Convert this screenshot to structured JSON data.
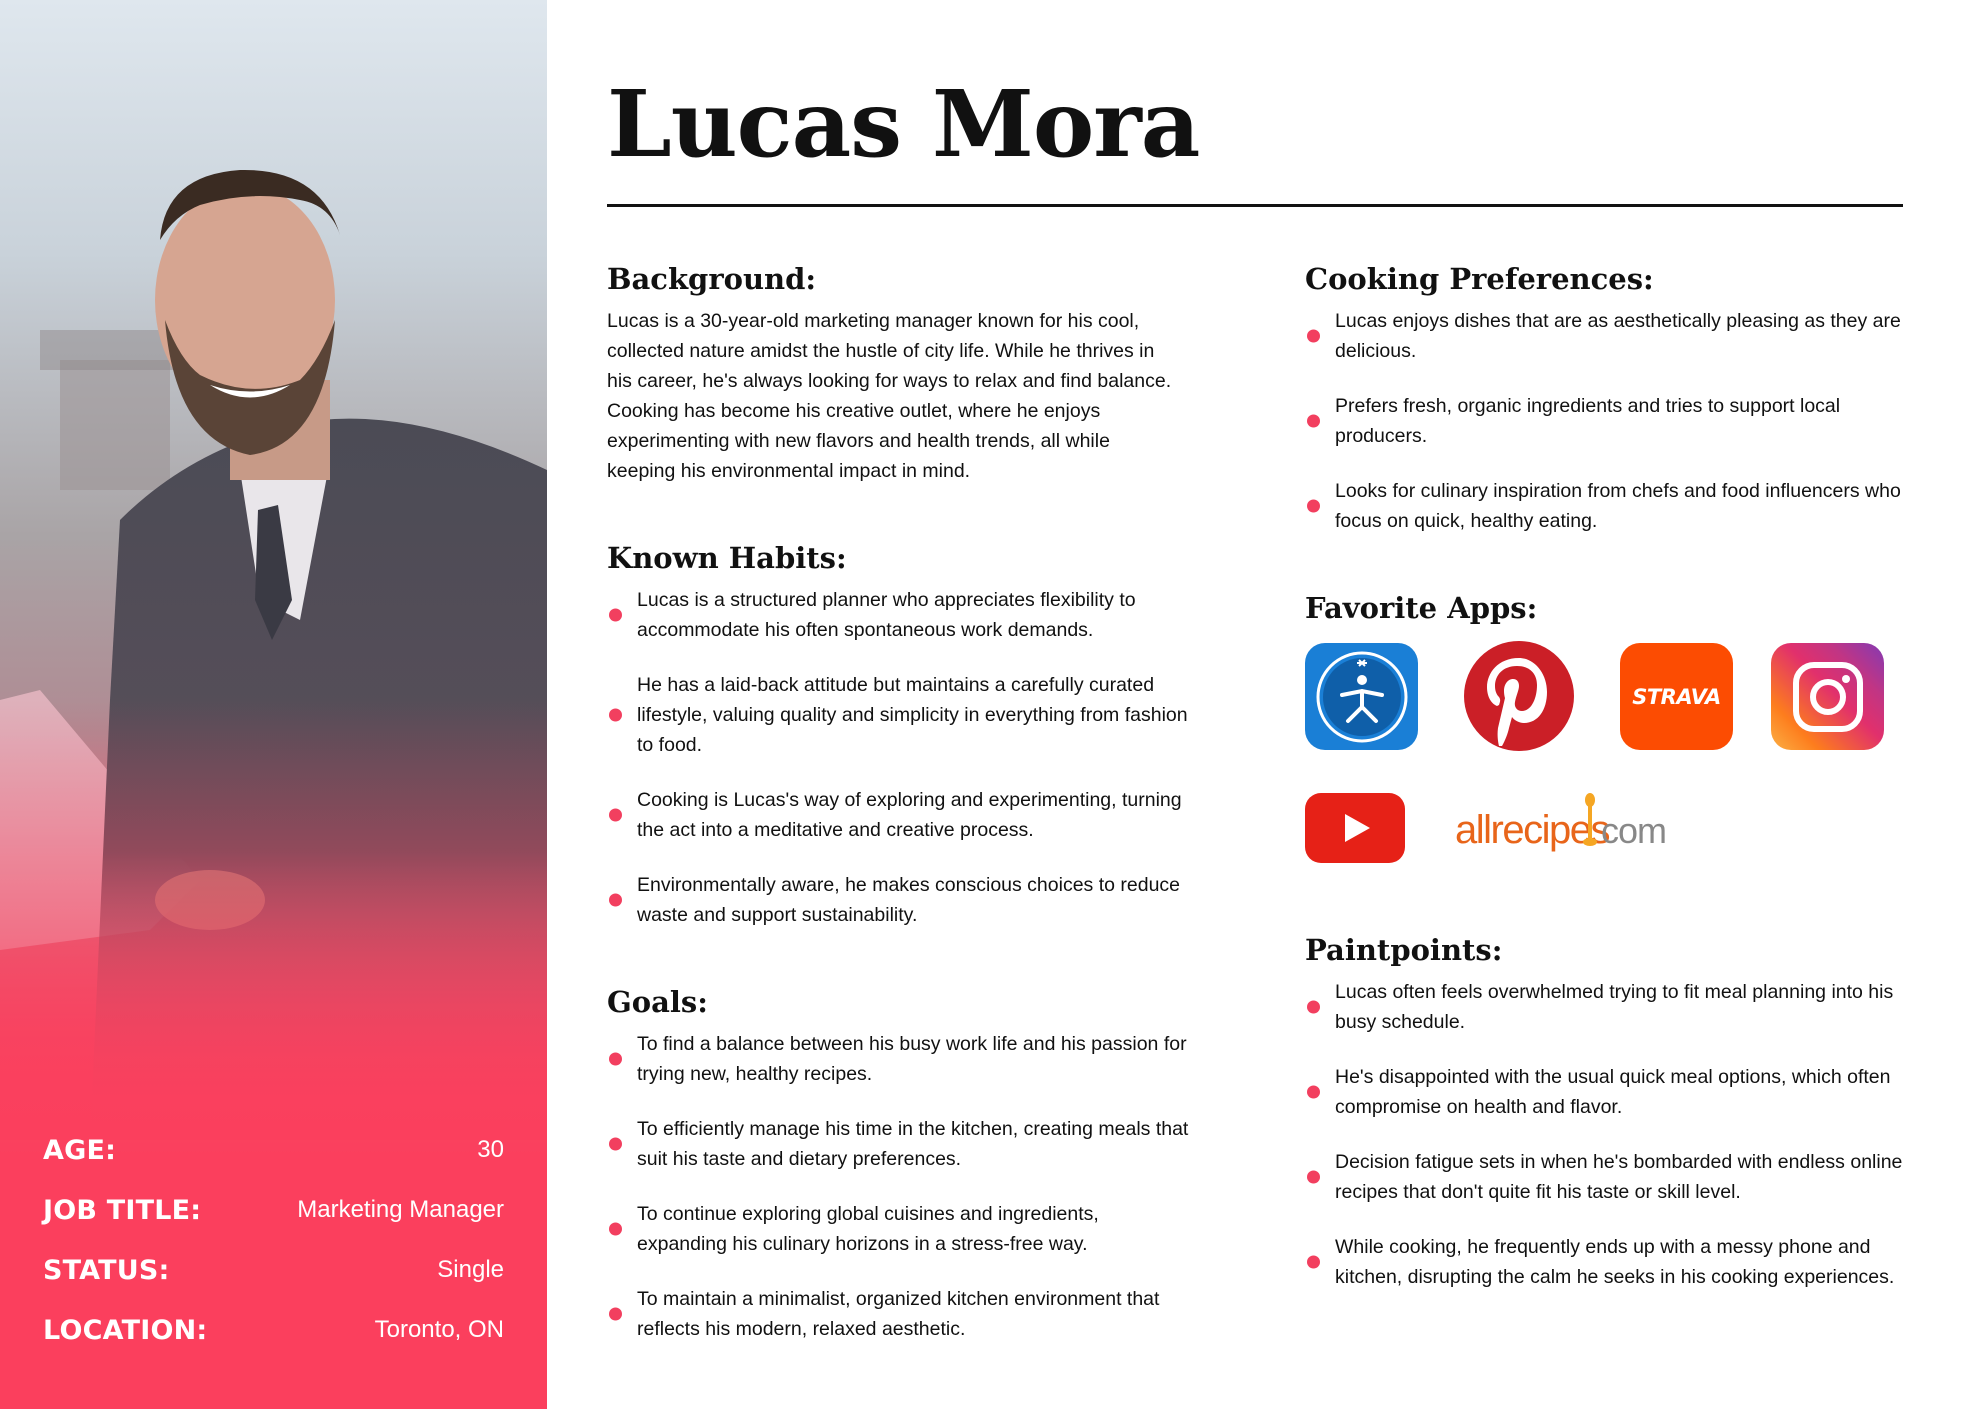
{
  "persona": {
    "name": "Lucas Mora",
    "stats": [
      {
        "label": "AGE:",
        "value": "30"
      },
      {
        "label": "JOB TITLE:",
        "value": "Marketing Manager"
      },
      {
        "label": "STATUS:",
        "value": "Single"
      },
      {
        "label": "LOCATION:",
        "value": "Toronto, ON"
      }
    ]
  },
  "background": {
    "heading": "Background:",
    "text": "Lucas is a 30-year-old marketing manager known for his cool, collected nature amidst the hustle of city life. While he thrives in his career, he's always looking for ways to relax and find balance. Cooking has become his creative outlet, where he enjoys experimenting with new flavors and health trends, all while keeping his environmental impact in mind."
  },
  "habits": {
    "heading": "Known Habits:",
    "items": [
      "Lucas is a structured planner who appreciates flexibility to accommodate his often spontaneous work demands.",
      "He has a laid-back attitude but maintains a carefully curated lifestyle, valuing quality and simplicity in everything from fashion to food.",
      "Cooking is Lucas's way of exploring and experimenting, turning the act into a meditative and creative process.",
      "Environmentally aware, he makes conscious choices to reduce waste and support sustainability."
    ]
  },
  "goals": {
    "heading": "Goals:",
    "items": [
      "To find a balance between his busy work life and his passion for trying new, healthy recipes.",
      "To efficiently manage his time in the kitchen, creating meals that suit his taste and dietary preferences.",
      "To continue exploring global cuisines and ingredients, expanding his culinary horizons in a stress-free way.",
      "To maintain a minimalist, organized kitchen environment that reflects his modern, relaxed aesthetic."
    ]
  },
  "cooking": {
    "heading": "Cooking Preferences:",
    "items": [
      "Lucas enjoys dishes that are as aesthetically pleasing as they are delicious.",
      "Prefers fresh, organic ingredients and tries to support local producers.",
      "Looks for culinary inspiration from chefs and food influencers who focus on quick, healthy eating."
    ]
  },
  "apps": {
    "heading": "Favorite Apps:",
    "strava_label": "STRAVA",
    "allrecipes_label": "allrecipes",
    "allrecipes_suffix": "com",
    "icons": [
      "myfitnesspal-icon",
      "pinterest-icon",
      "strava-icon",
      "instagram-icon",
      "youtube-icon",
      "allrecipes-logo"
    ]
  },
  "painpoints": {
    "heading": "Paintpoints:",
    "items": [
      "Lucas often feels overwhelmed trying to fit meal planning into his busy schedule.",
      "He's disappointed with the usual quick meal options, which often compromise on health and flavor.",
      "Decision fatigue sets in when he's bombarded with endless online recipes that don't quite fit his taste or skill level.",
      "While cooking, he frequently ends up with a messy phone and kitchen, disrupting the calm he seeks in his cooking experiences."
    ]
  },
  "colors": {
    "accent": "#f23f5f",
    "panel": "#fb3f5d",
    "text": "#111111"
  }
}
